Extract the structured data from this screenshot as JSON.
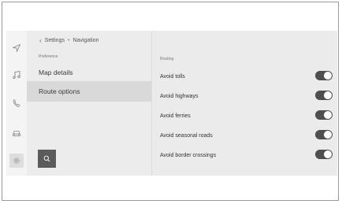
{
  "header": {
    "breadcrumb_parent": "Settings",
    "breadcrumb_separator": "•",
    "breadcrumb_current": "Navigation",
    "back_icon": "chevron-left-icon"
  },
  "sidebar_icons": [
    {
      "name": "navigation-icon",
      "selected": false
    },
    {
      "name": "music-icon",
      "selected": false
    },
    {
      "name": "phone-icon",
      "selected": false
    },
    {
      "name": "car-icon",
      "selected": false
    },
    {
      "name": "settings-gear-icon",
      "selected": true
    }
  ],
  "left_panel": {
    "section_label": "Preference",
    "items": [
      {
        "label": "Map details",
        "selected": false
      },
      {
        "label": "Route options",
        "selected": true
      }
    ],
    "search_icon": "search-icon"
  },
  "right_panel": {
    "section_label": "Routing",
    "options": [
      {
        "label": "Avoid tolls",
        "enabled": true
      },
      {
        "label": "Avoid highways",
        "enabled": true
      },
      {
        "label": "Avoid ferries",
        "enabled": true
      },
      {
        "label": "Avoid seasonal roads",
        "enabled": true
      },
      {
        "label": "Avoid border crossings",
        "enabled": true
      }
    ]
  },
  "colors": {
    "toggle_on": "#4f4f4f",
    "selected_row": "#d9d9d9",
    "search_button": "#5b5b5b",
    "screen_bg": "#ebebeb"
  }
}
